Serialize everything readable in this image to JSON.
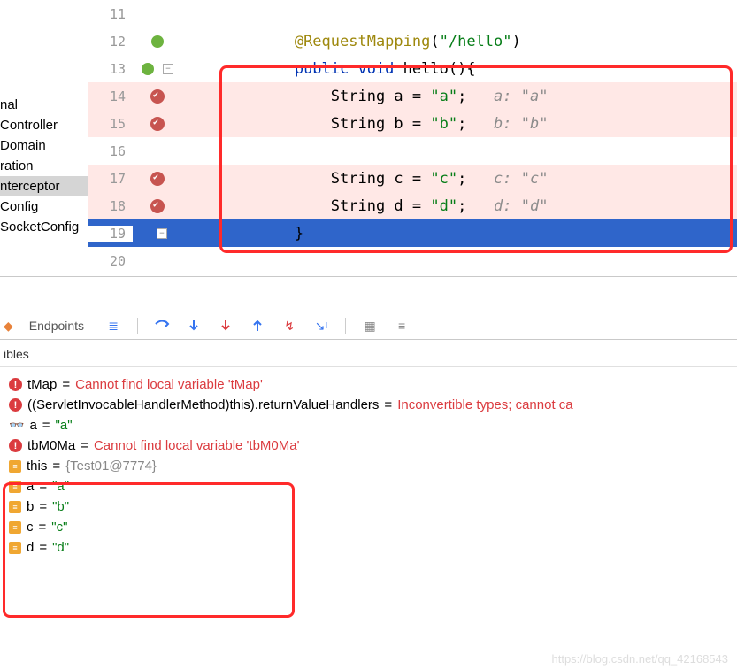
{
  "sidebar": {
    "items": [
      {
        "label": "nal"
      },
      {
        "label": "Controller"
      },
      {
        "label": "Domain"
      },
      {
        "label": "ration"
      },
      {
        "label": "nterceptor"
      },
      {
        "label": "Config"
      },
      {
        "label": "SocketConfig"
      }
    ]
  },
  "code": {
    "lines": [
      {
        "num": "11",
        "bp": false,
        "tokens": []
      },
      {
        "num": "12",
        "bp": false,
        "spring": true,
        "indent": "            ",
        "tokens": [
          {
            "t": "annot",
            "v": "@RequestMapping"
          },
          {
            "t": "id",
            "v": "("
          },
          {
            "t": "str",
            "v": "\"/hello\""
          },
          {
            "t": "id",
            "v": ")"
          }
        ]
      },
      {
        "num": "13",
        "bp": false,
        "spring": true,
        "fold": true,
        "indent": "            ",
        "tokens": [
          {
            "t": "kw",
            "v": "public void "
          },
          {
            "t": "id",
            "v": "hello(){"
          }
        ]
      },
      {
        "num": "14",
        "bp": true,
        "indent": "                ",
        "tokens": [
          {
            "t": "id",
            "v": "String a = "
          },
          {
            "t": "str",
            "v": "\"a\""
          },
          {
            "t": "id",
            "v": ";   "
          },
          {
            "t": "comment",
            "v": "a: \"a\""
          }
        ]
      },
      {
        "num": "15",
        "bp": true,
        "indent": "                ",
        "tokens": [
          {
            "t": "id",
            "v": "String b = "
          },
          {
            "t": "str",
            "v": "\"b\""
          },
          {
            "t": "id",
            "v": ";   "
          },
          {
            "t": "comment",
            "v": "b: \"b\""
          }
        ]
      },
      {
        "num": "16",
        "bp": false,
        "tokens": []
      },
      {
        "num": "17",
        "bp": true,
        "indent": "                ",
        "tokens": [
          {
            "t": "id",
            "v": "String c = "
          },
          {
            "t": "str",
            "v": "\"c\""
          },
          {
            "t": "id",
            "v": ";   "
          },
          {
            "t": "comment",
            "v": "c: \"c\""
          }
        ]
      },
      {
        "num": "18",
        "bp": true,
        "indent": "                ",
        "tokens": [
          {
            "t": "id",
            "v": "String d = "
          },
          {
            "t": "str",
            "v": "\"d\""
          },
          {
            "t": "id",
            "v": ";   "
          },
          {
            "t": "comment",
            "v": "d: \"d\""
          }
        ]
      },
      {
        "num": "19",
        "sel": true,
        "fold2": true,
        "indent": "            ",
        "tokens": [
          {
            "t": "id",
            "v": "}"
          }
        ]
      },
      {
        "num": "20",
        "bp": false,
        "tokens": []
      }
    ]
  },
  "toolbar": {
    "endpoints": "Endpoints"
  },
  "vars": {
    "header": "ibles",
    "rows": [
      {
        "icon": "err",
        "name": "tMap",
        "eq": " = ",
        "val": "Cannot find local variable 'tMap'",
        "cls": "err"
      },
      {
        "icon": "err",
        "name": "((ServletInvocableHandlerMethod)this).returnValueHandlers",
        "eq": " = ",
        "val": "Inconvertible types; cannot ca",
        "cls": "err"
      },
      {
        "icon": "glasses",
        "name": "a",
        "eq": " = ",
        "val": "\"a\"",
        "cls": "val"
      },
      {
        "icon": "err",
        "name": "tbM0Ma",
        "eq": " = ",
        "val": "Cannot find local variable 'tbM0Ma'",
        "cls": "err"
      },
      {
        "icon": "field",
        "name": "this",
        "eq": " = ",
        "val": "{Test01@7774}",
        "cls": "obj"
      },
      {
        "icon": "field",
        "name": "a",
        "eq": " = ",
        "val": "\"a\"",
        "cls": "val"
      },
      {
        "icon": "field",
        "name": "b",
        "eq": " = ",
        "val": "\"b\"",
        "cls": "val"
      },
      {
        "icon": "field",
        "name": "c",
        "eq": " = ",
        "val": "\"c\"",
        "cls": "val"
      },
      {
        "icon": "field",
        "name": "d",
        "eq": " = ",
        "val": "\"d\"",
        "cls": "val"
      }
    ]
  },
  "watermark": "https://blog.csdn.net/qq_42168543"
}
